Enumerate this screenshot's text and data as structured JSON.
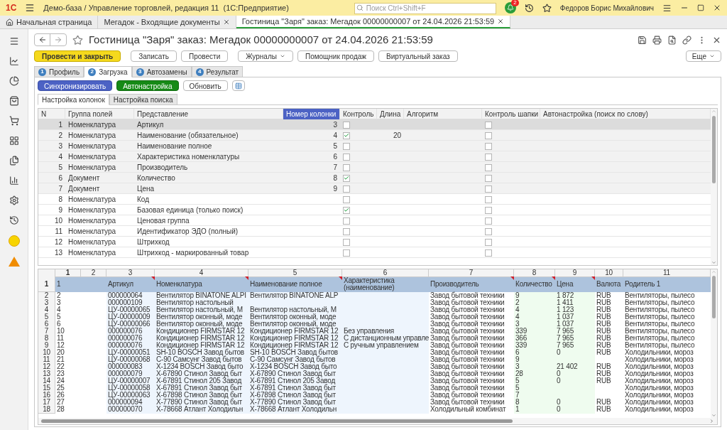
{
  "app_bar": {
    "logo": "1С",
    "title": "Демо-база / Управление торговлей, редакция 11  (1С:Предприятие)",
    "search": {
      "placeholder": "Поиск Ctrl+Shift+F"
    },
    "notifications": "2",
    "user": "Федоров Борис Михайлович"
  },
  "open_tabs": [
    {
      "label": "Начальная страница",
      "kind": "home",
      "selected": false
    },
    {
      "label": "Мегадок - Входящие документы",
      "kind": "closable",
      "selected": false
    },
    {
      "label": "Гостиница \"Заря\" заказ: Мегадок 00000000007 от 24.04.2026 21:53:59",
      "kind": "closable",
      "selected": true
    }
  ],
  "form": {
    "title": "Гостиница \"Заря\" заказ: Мегадок 00000000007 от 24.04.2026 21:53:59",
    "toolbar": [
      {
        "label": "Провести и закрыть",
        "kind": "primary"
      },
      {
        "label": "Записать",
        "kind": "plain"
      },
      {
        "label": "Провести",
        "kind": "plain"
      },
      {
        "label": "Журналы",
        "kind": "dropdown"
      },
      {
        "label": "Помощник продаж",
        "kind": "plain"
      },
      {
        "label": "Виртуальный заказ",
        "kind": "plain"
      }
    ],
    "more": "Еще",
    "steps": [
      {
        "number": "1",
        "label": "Профиль",
        "selected": false
      },
      {
        "number": "2",
        "label": "Загрузка",
        "selected": true
      },
      {
        "number": "3",
        "label": "Автозамены",
        "selected": false
      },
      {
        "number": "4",
        "label": "Результат",
        "selected": false
      }
    ],
    "actions": [
      {
        "label": "Синхронизировать",
        "kind": "blue"
      },
      {
        "label": "Автонастройка",
        "kind": "green"
      },
      {
        "label": "Обновить",
        "kind": "plain"
      }
    ],
    "subtabs": [
      {
        "label": "Настройка колонок",
        "selected": true
      },
      {
        "label": "Настройка поиска",
        "selected": false
      }
    ],
    "columns_table": {
      "columns": [
        {
          "label": "N",
          "selected": false
        },
        {
          "label": "Группа полей",
          "selected": false
        },
        {
          "label": "Представление",
          "selected": false
        },
        {
          "label": "Номер колонки",
          "selected": true
        },
        {
          "label": "Контроль",
          "selected": false
        },
        {
          "label": "Длина",
          "selected": false
        },
        {
          "label": "Алгоритм",
          "selected": false
        },
        {
          "label": "Контроль шапки",
          "selected": false
        },
        {
          "label": "Автонастройка (поиск по слову)",
          "selected": false
        }
      ],
      "rows": [
        {
          "n": "1",
          "group": "Номенклатура",
          "field": "Артикул",
          "column_number": "3",
          "control": false,
          "header_control": false,
          "selected": true
        },
        {
          "n": "2",
          "group": "Номенклатура",
          "field": "Наименование (обязательное)",
          "column_number": "4",
          "control": true,
          "length": "20",
          "header_control": false,
          "selected": false
        },
        {
          "n": "3",
          "group": "Номенклатура",
          "field": "Наименование полное",
          "column_number": "5",
          "control": false,
          "header_control": false,
          "selected": false
        },
        {
          "n": "4",
          "group": "Номенклатура",
          "field": "Характеристика номенклатуры",
          "column_number": "6",
          "control": false,
          "header_control": false,
          "selected": false
        },
        {
          "n": "5",
          "group": "Номенклатура",
          "field": "Производитель",
          "column_number": "7",
          "control": false,
          "header_control": false,
          "selected": false
        },
        {
          "n": "6",
          "group": "Документ",
          "field": "Количество",
          "column_number": "8",
          "control": true,
          "header_control": false,
          "selected": false
        },
        {
          "n": "7",
          "group": "Документ",
          "field": "Цена",
          "column_number": "9",
          "control": false,
          "header_control": false,
          "selected": false
        },
        {
          "n": "8",
          "group": "Номенклатура",
          "field": "Код",
          "control": false,
          "header_control": false,
          "selected": false
        },
        {
          "n": "9",
          "group": "Номенклатура",
          "field": "Базовая единица (только поиск)",
          "control": true,
          "header_control": false,
          "selected": false
        },
        {
          "n": "10",
          "group": "Номенклатура",
          "field": "Ценовая группа",
          "control": false,
          "header_control": false,
          "selected": false
        },
        {
          "n": "11",
          "group": "Номенклатура",
          "field": "Идентификатор ЭДО (полный)",
          "control": false,
          "header_control": false,
          "selected": false
        },
        {
          "n": "12",
          "group": "Номенклатура",
          "field": "Штрихкод",
          "control": false,
          "header_control": false,
          "selected": false
        },
        {
          "n": "13",
          "group": "Номенклатура",
          "field": "Штрихкод - маркированный товар",
          "control": false,
          "header_control": false,
          "selected": false
        }
      ]
    },
    "sheet": {
      "column_numbers": [
        "1",
        "2",
        "3",
        "4",
        "5",
        "6",
        "7",
        "8",
        "9",
        "10",
        "11"
      ],
      "header": {
        "number": "1",
        "cells": [
          {
            "text": "1",
            "comment": false
          },
          {
            "comment": false
          },
          {
            "text": "Артикул",
            "comment": true
          },
          {
            "text": "Номенклатура",
            "comment": true
          },
          {
            "text": "Наименование полное",
            "comment": true
          },
          {
            "text": "Характеристика (наименование)",
            "comment": false
          },
          {
            "text": "Производитель",
            "comment": true
          },
          {
            "text": "Количество",
            "comment": true
          },
          {
            "text": "Цена",
            "comment": true
          },
          {
            "text": "Валюта",
            "comment": false
          },
          {
            "text": "Родитель 1",
            "comment": false
          }
        ]
      },
      "rows": [
        {
          "number": "2",
          "cells": [
            "2",
            null,
            "000000064",
            "Вентилятор BINATONE ALPI",
            "Вентилятор BINATONE ALP",
            null,
            "Завод бытовой техники",
            "9",
            "1 872",
            "RUB",
            "Вентиляторы, пылесо"
          ]
        },
        {
          "number": "3",
          "cells": [
            "3",
            null,
            "000000109",
            "Вентилятор настольный",
            null,
            null,
            "Завод бытовой техники",
            "2",
            "1 411",
            "RUB",
            "Вентиляторы, пылесо"
          ]
        },
        {
          "number": "4",
          "cells": [
            "4",
            null,
            "ЦУ-00000065",
            "Вентилятор настольный, М",
            "Вентилятор настольный, М",
            null,
            "Завод бытовой техники",
            "4",
            "1 123",
            "RUB",
            "Вентиляторы, пылесо"
          ]
        },
        {
          "number": "5",
          "cells": [
            "5",
            null,
            "ЦУ-00000009",
            "Вентилятор оконный, моде",
            "Вентилятор оконный, моде",
            null,
            "Завод бытовой техники",
            "4",
            "1 037",
            "RUB",
            "Вентиляторы, пылесо"
          ]
        },
        {
          "number": "6",
          "cells": [
            "6",
            null,
            "ЦУ-00000066",
            "Вентилятор оконный, моде",
            "Вентилятор оконный, моде",
            null,
            "Завод бытовой техники",
            "3",
            "1 037",
            "RUB",
            "Вентиляторы, пылесо"
          ]
        },
        {
          "number": "7",
          "cells": [
            "10",
            null,
            "000000076",
            "Кондиционер FIRMSTAR 12",
            "Кондиционер FIRMSTAR 12",
            "Без управления",
            "Завод бытовой техники",
            "339",
            "7 965",
            "RUB",
            "Вентиляторы, пылесо"
          ]
        },
        {
          "number": "8",
          "cells": [
            "11",
            null,
            "000000076",
            "Кондиционер FIRMSTAR 12",
            "Кондиционер FIRMSTAR 12",
            "С дистанционным управле",
            "Завод бытовой техники",
            "366",
            "7 965",
            "RUB",
            "Вентиляторы, пылесо"
          ]
        },
        {
          "number": "9",
          "cells": [
            "12",
            null,
            "000000076",
            "Кондиционер FIRMSTAR 12",
            "Кондиционер FIRMSTAR 12",
            "С ручным управлением",
            "Завод бытовой техники",
            "339",
            "7 965",
            "RUB",
            "Вентиляторы, пылесо"
          ]
        },
        {
          "number": "10",
          "cells": [
            "20",
            null,
            "ЦУ-00000051",
            "SH-10 BOSCH Завод бытов",
            "SH-10 BOSCH Завод бытов",
            null,
            "Завод бытовой техники",
            "6",
            "0",
            "RUB",
            "Холодильники, мороз"
          ]
        },
        {
          "number": "11",
          "cells": [
            "21",
            null,
            "ЦУ-00000068",
            "С-90 Самсунг Завод бытов",
            "С-90 Самсунг Завод бытов",
            null,
            "Завод бытовой техники",
            "9",
            null,
            null,
            "Холодильники, мороз"
          ]
        },
        {
          "number": "12",
          "cells": [
            "22",
            null,
            "000000083",
            "Х-1234 BOSCH Завод быто",
            "Х-1234 BOSCH Завод быто",
            null,
            "Завод бытовой техники",
            "3",
            "21 402",
            "RUB",
            "Холодильники, мороз"
          ]
        },
        {
          "number": "13",
          "cells": [
            "23",
            null,
            "000000079",
            "Х-67890 Стинол Завод быт",
            "Х-67890 Стинол Завод быт",
            null,
            "Завод бытовой техники",
            "28",
            "0",
            "RUB",
            "Холодильники, мороз"
          ]
        },
        {
          "number": "14",
          "cells": [
            "24",
            null,
            "ЦУ-00000007",
            "Х-67891 Стинол 205 Завод",
            "Х-67891 Стинол 205 Завод",
            null,
            "Завод бытовой техники",
            "5",
            "0",
            "RUB",
            "Холодильники, мороз"
          ]
        },
        {
          "number": "15",
          "cells": [
            "25",
            null,
            "ЦУ-00000058",
            "Х-67891 Стинол Завод быт",
            "Х-67891 Стинол Завод быт",
            null,
            "Завод бытовой техники",
            "5",
            null,
            null,
            "Холодильники, мороз"
          ]
        },
        {
          "number": "16",
          "cells": [
            "26",
            null,
            "ЦУ-00000063",
            "Х-67898 Стинол Завод быт",
            "Х-67898 Стинол Завод быт",
            null,
            "Завод бытовой техники",
            "7",
            null,
            null,
            "Холодильники, мороз"
          ]
        },
        {
          "number": "17",
          "cells": [
            "27",
            null,
            "000000094",
            "Х-77890 Стинол Завод быт",
            "Х-77890 Стинол Завод быт",
            null,
            "Завод бытовой техники",
            "8",
            "0",
            "RUB",
            "Холодильники, мороз"
          ]
        },
        {
          "number": "18",
          "cells": [
            "28",
            null,
            "000000070",
            "Х-78668 Атлант Холодильн",
            "Х-78668 Атлант Холодильн",
            null,
            "Холодильный комбинат",
            "1",
            "0",
            "RUB",
            "Холодильники, мороз"
          ]
        }
      ]
    }
  }
}
